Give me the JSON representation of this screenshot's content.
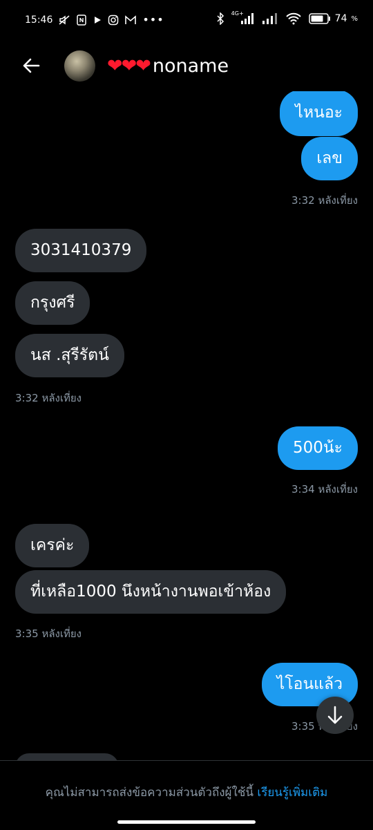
{
  "status_bar": {
    "time": "15:46",
    "network": "4G+",
    "battery": "74"
  },
  "header": {
    "back_icon": "arrow-left-icon",
    "hearts": "❤❤❤",
    "name": "noname"
  },
  "messages": [
    {
      "dir": "out",
      "text": "ไหนอะ"
    },
    {
      "dir": "out",
      "text": "เลข"
    },
    {
      "time": "3:32 หลังเที่ยง"
    },
    {
      "dir": "in",
      "text": "3031410379"
    },
    {
      "dir": "in",
      "text": "กรุงศรี"
    },
    {
      "dir": "in",
      "text": "นส .สุรีรัตน์"
    },
    {
      "time": "3:32 หลังเที่ยง"
    },
    {
      "dir": "out",
      "text": "500น้ะ"
    },
    {
      "time": "3:34 หลังเที่ยง"
    },
    {
      "dir": "in",
      "text": "เครค่ะ"
    },
    {
      "dir": "in",
      "text": "ที่เหลือ1000 นึงหน้างานพอเข้าห้อง"
    },
    {
      "time": "3:35 หลังเที่ยง"
    },
    {
      "dir": "out",
      "text": "ไโอนแล้ว"
    },
    {
      "time": "3:35 หลังเที่ยง"
    }
  ],
  "scroll_button_icon": "arrow-down-icon",
  "footer": {
    "text": "คุณไม่สามารถส่งข้อความส่วนตัวถึงผู้ใช้นี้ ",
    "link": "เรียนรู้เพิ่มเติม"
  }
}
